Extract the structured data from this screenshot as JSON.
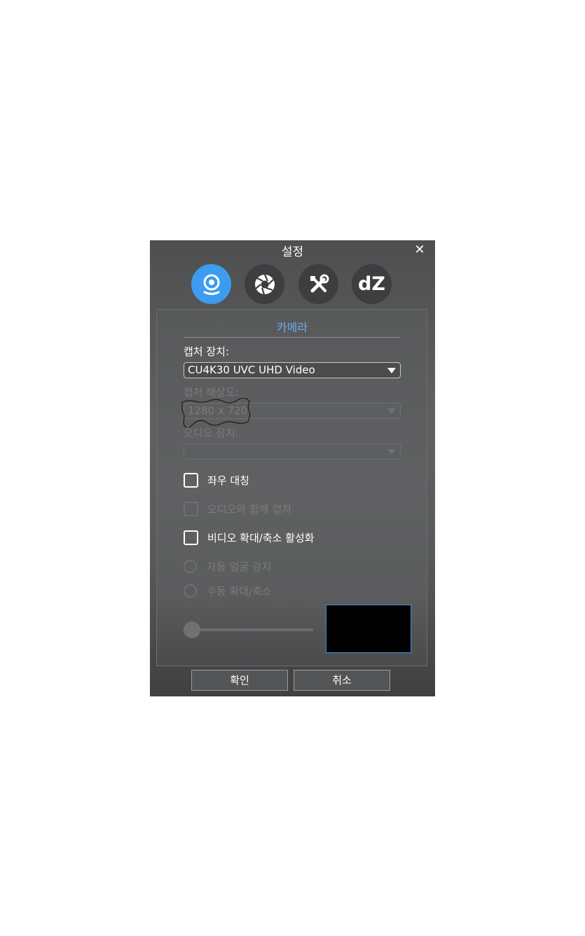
{
  "dialog": {
    "title": "설정",
    "close_icon": "close-icon",
    "tabs": [
      {
        "icon": "webcam-icon",
        "active": true
      },
      {
        "icon": "aperture-icon",
        "active": false
      },
      {
        "icon": "tools-icon",
        "active": false
      },
      {
        "icon": "dz-logo-icon",
        "label": "dZ",
        "active": false
      }
    ],
    "accent_color": "#3d9cf0"
  },
  "camera": {
    "heading": "카메라",
    "capture_device_label": "캡처 장치:",
    "capture_device_value": "CU4K30 UVC UHD Video",
    "capture_resolution_label": "캡처 해상도:",
    "capture_resolution_value": "1280 x 720",
    "audio_device_label": "오디오 장치:",
    "audio_device_value": "",
    "mirror_label": "좌우 대칭",
    "capture_with_audio_label": "오디오와 함께 캡처",
    "enable_zoom_label": "비디오 확대/축소 활성화",
    "auto_face_detect_label": "자동 얼굴 감지",
    "manual_zoom_label": "수동 확대/축소"
  },
  "footer": {
    "ok_label": "확인",
    "cancel_label": "취소"
  }
}
